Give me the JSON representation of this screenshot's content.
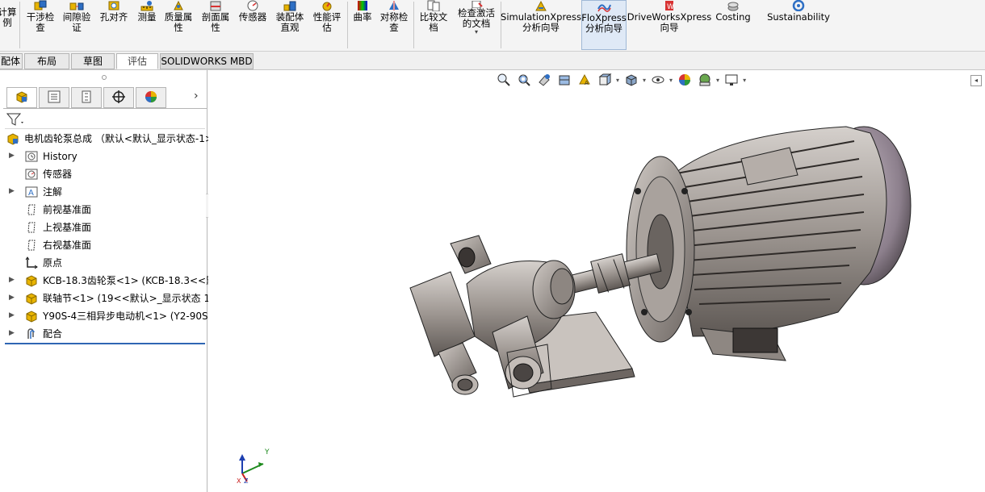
{
  "ribbon": {
    "items": [
      {
        "id": "calc",
        "label": "计算\n例",
        "icon": "calculator-icon"
      },
      {
        "id": "interference",
        "label": "干涉检\n查",
        "icon": "interference-check-icon"
      },
      {
        "id": "clearance",
        "label": "间隙验\n证",
        "icon": "clearance-verify-icon"
      },
      {
        "id": "hole-align",
        "label": "孔对齐",
        "icon": "hole-align-icon"
      },
      {
        "id": "measure",
        "label": "测量",
        "icon": "measure-icon"
      },
      {
        "id": "mass-props",
        "label": "质量属\n性",
        "icon": "mass-properties-icon"
      },
      {
        "id": "section-props",
        "label": "剖面属\n性",
        "icon": "section-properties-icon"
      },
      {
        "id": "sensor",
        "label": "传感器",
        "icon": "sensor-icon"
      },
      {
        "id": "assembly-visual",
        "label": "装配体\n直观",
        "icon": "assembly-visualization-icon"
      },
      {
        "id": "perf-eval",
        "label": "性能评\n估",
        "icon": "performance-evaluation-icon"
      },
      {
        "id": "curvature",
        "label": "曲率",
        "icon": "curvature-icon"
      },
      {
        "id": "symmetry",
        "label": "对称检\n查",
        "icon": "symmetry-check-icon"
      },
      {
        "id": "compare-docs",
        "label": "比较文\n档",
        "icon": "compare-documents-icon"
      },
      {
        "id": "check-active",
        "label": "检查激活\n的文档",
        "icon": "check-active-document-icon"
      },
      {
        "id": "simxpress",
        "label": "SimulationXpress\n分析向导",
        "icon": "simulationxpress-icon"
      },
      {
        "id": "floxpress",
        "label": "FloXpress\n分析向导",
        "icon": "floxpress-icon"
      },
      {
        "id": "driveworks",
        "label": "DriveWorksXpress\n向导",
        "icon": "driveworksxpress-icon"
      },
      {
        "id": "costing",
        "label": "Costing",
        "icon": "costing-icon"
      },
      {
        "id": "sustainability",
        "label": "Sustainability",
        "icon": "sustainability-icon"
      }
    ],
    "colors": {
      "accent": "#2f66b3",
      "icon_yellow": "#e8b400",
      "icon_blue": "#2e6fc4",
      "icon_red": "#d83232"
    }
  },
  "cm_tabs": [
    {
      "label": "配体"
    },
    {
      "label": "布局"
    },
    {
      "label": "草图"
    },
    {
      "label": "评估",
      "active": true
    },
    {
      "label": "SOLIDWORKS MBD"
    }
  ],
  "tree": {
    "root": "电机齿轮泵总成 （默认<默认_显示状态-1>",
    "items": [
      {
        "label": "History",
        "icon": "history-icon",
        "expandable": true
      },
      {
        "label": "传感器",
        "icon": "sensors-folder-icon",
        "expandable": false
      },
      {
        "label": "注解",
        "icon": "annotations-icon",
        "expandable": true
      },
      {
        "label": "前视基准面",
        "icon": "plane-icon",
        "expandable": false
      },
      {
        "label": "上视基准面",
        "icon": "plane-icon",
        "expandable": false
      },
      {
        "label": "右视基准面",
        "icon": "plane-icon",
        "expandable": false
      },
      {
        "label": "原点",
        "icon": "origin-icon",
        "expandable": false
      },
      {
        "label": "KCB-18.3齿轮泵<1> (KCB-18.3<<默",
        "icon": "part-icon",
        "expandable": true
      },
      {
        "label": "联轴节<1> (19<<默认>_显示状态 1",
        "icon": "part-icon",
        "expandable": true
      },
      {
        "label": "Y90S-4三相异步电动机<1> (Y2-90S-",
        "icon": "part-icon",
        "expandable": true
      },
      {
        "label": "配合",
        "icon": "mates-icon",
        "expandable": true
      }
    ]
  },
  "triad": {
    "y_label": "Y",
    "x_label": "X",
    "z_label": "Z"
  }
}
